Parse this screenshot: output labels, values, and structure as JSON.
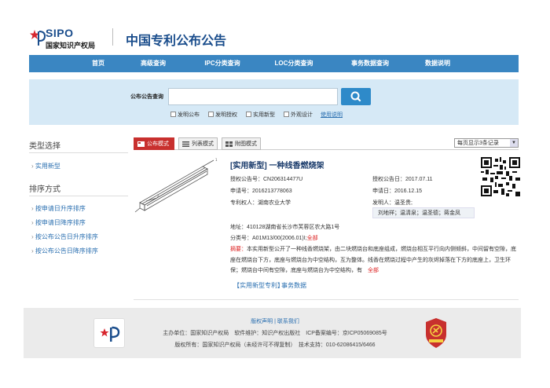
{
  "header": {
    "logo_sipo": "SIPO",
    "logo_cn": "国家知识产权局",
    "site_title": "中国专利公布公告"
  },
  "nav": {
    "items": [
      "首页",
      "高级查询",
      "IPC分类查询",
      "LOC分类查询",
      "事务数据查询",
      "数据说明"
    ]
  },
  "search": {
    "label": "公布公告查询",
    "value": "",
    "checks": [
      "发明公布",
      "发明授权",
      "实用新型",
      "外观设计"
    ],
    "help": "使用说明"
  },
  "sidebar": {
    "type_heading": "类型选择",
    "type_items": [
      "实用新型"
    ],
    "sort_heading": "排序方式",
    "sort_items": [
      "按申请日升序排序",
      "按申请日降序排序",
      "按公布公告日升序排序",
      "按公布公告日降序排序"
    ]
  },
  "tabs": {
    "items": [
      "公布模式",
      "列表模式",
      "附图模式"
    ],
    "per_page": "每页显示3条记录"
  },
  "result": {
    "title": "[实用新型] 一种线香燃烧架",
    "pub_no": "授权公告号：CN206314477U",
    "pub_date": "授权公告日：2017.07.11",
    "app_no": "申请号：2016213778063",
    "app_date": "申请日：2016.12.15",
    "owner": "专利权人：湖南农业大学",
    "inventor": "发明人：温圣贵;",
    "inventor_list": "刘地祥；温清泉；温圣德；蒋金凤",
    "address": "地址：410128湖南省长沙市芙蓉区农大路1号",
    "classification": "分类号：A01M13/00(2006.01)I;",
    "all1": "全部",
    "abstract_label": "摘要：",
    "abstract": "本实用新型公开了一种线香燃烧架，由二块燃烧台和底座组成，燃烧台相互平行向内侧倾斜，中间留有空隙，底座在燃烧台下方，底座与燃烧台为中空结构，互为整体。线香在燃烧过程中产生的灰烬掉落在下方的底座上，卫生环保；燃烧台中间有空隙，底座与燃烧台为中空结构，有",
    "all2": "全部",
    "link1": "【实用新型专利】",
    "link2": "事务数据"
  },
  "footer": {
    "links": "版权声明 | 联系我们",
    "line2": "主办单位：国家知识产权局　软件维护：知识产权出版社　ICP备案编号：京ICP05069085号",
    "line3": "版权所有：国家知识产权局（未经许可不得复制）　技术支持：010-62086415/6466"
  },
  "colors": {
    "nav_bg": "#3a86c2",
    "search_band": "#d6e9f6",
    "accent_red": "#c8302e",
    "title_blue": "#1a4d8c"
  }
}
